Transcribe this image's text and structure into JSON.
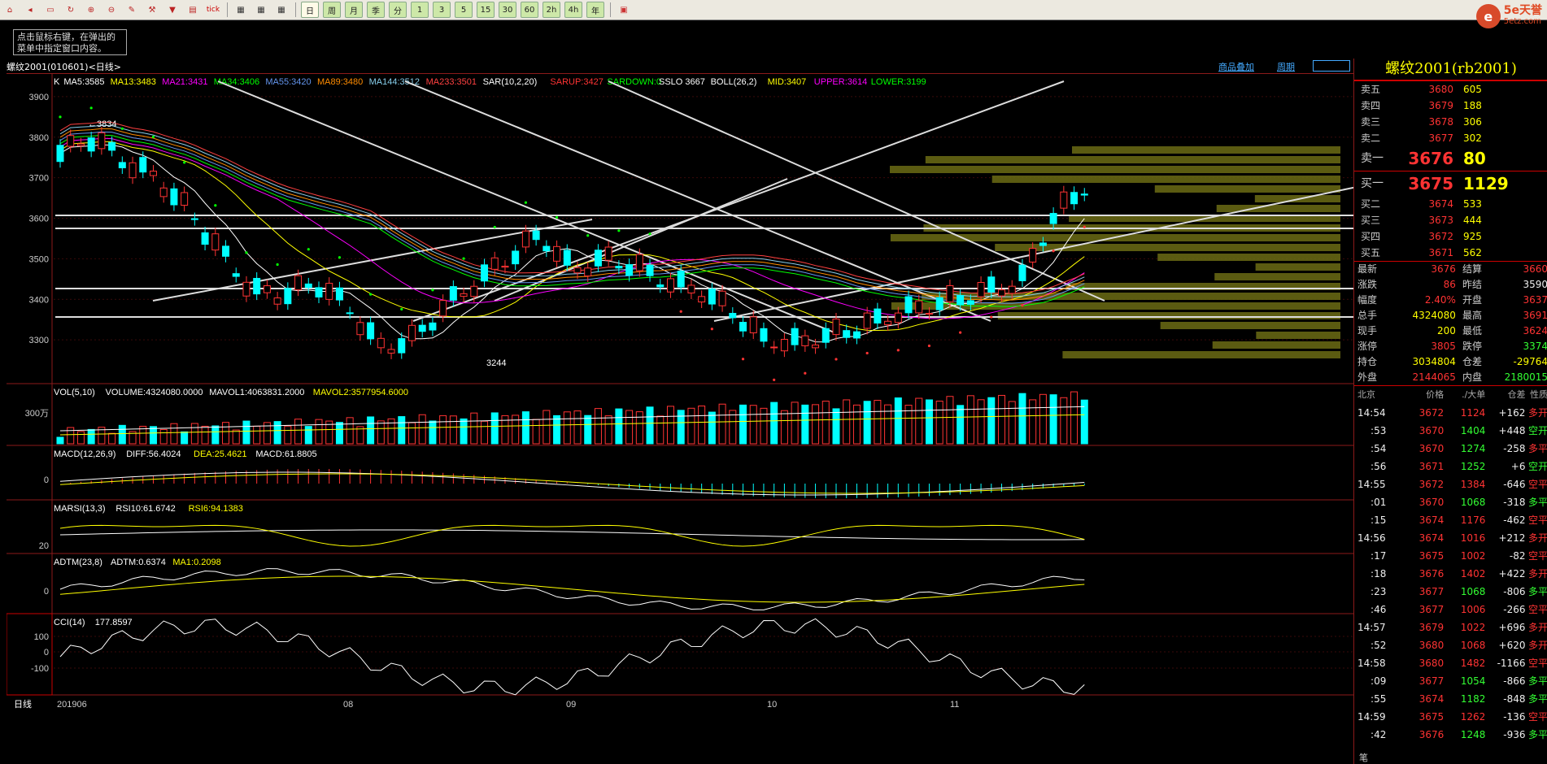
{
  "toolbar": {
    "icons": [
      "home-icon",
      "back-icon",
      "folder-icon",
      "refresh-icon",
      "zoom-in-icon",
      "zoom-out-icon",
      "pen-icon",
      "tool-icon",
      "filter-icon",
      "news-icon"
    ],
    "periods": [
      "日",
      "周",
      "月",
      "季",
      "分",
      "1",
      "3",
      "5",
      "15",
      "30",
      "60",
      "2h",
      "4h",
      "年"
    ],
    "tick_label": "tick",
    "active_period": "日"
  },
  "logo": {
    "brand": "5e天誉",
    "domain": "5etz.com"
  },
  "hint": {
    "text": "点击鼠标右键，在弹出的菜单中指定窗口内容。"
  },
  "header": {
    "symbol": "螺纹2001",
    "code": "(010601)",
    "period": "<日线>",
    "link_add": "商品叠加",
    "link_period": "周期"
  },
  "main_indicators": [
    {
      "text": "K",
      "color": "#ffffff"
    },
    {
      "text": "MA5:3585",
      "color": "#ffffff"
    },
    {
      "text": "MA13:3483",
      "color": "#ffff00"
    },
    {
      "text": "MA21:3431",
      "color": "#ff00ff"
    },
    {
      "text": "MA34:3406",
      "color": "#00ff00"
    },
    {
      "text": "MA55:3420",
      "color": "#6495ed"
    },
    {
      "text": "MA89:3480",
      "color": "#ff8c00"
    },
    {
      "text": "MA144:3512",
      "color": "#87ceeb"
    },
    {
      "text": "MA233:3501",
      "color": "#ff4040"
    },
    {
      "text": "SAR(10,2,20)",
      "color": "#ffffff"
    },
    {
      "text": "SARUP:3427",
      "color": "#ff3333"
    },
    {
      "text": "SARDOWN:0",
      "color": "#00ff00"
    },
    {
      "text": "SSLO 3667",
      "color": "#ffffff"
    },
    {
      "text": "BOLL(26,2)",
      "color": "#ffffff"
    },
    {
      "text": "MID:3407",
      "color": "#ffff00"
    },
    {
      "text": "UPPER:3614",
      "color": "#ff00ff"
    },
    {
      "text": "LOWER:3199",
      "color": "#00ff00"
    }
  ],
  "price_axis": [
    "3900",
    "3800",
    "3700",
    "3600",
    "3500",
    "3400",
    "3300"
  ],
  "price_high_label": "3834",
  "price_low_label": "3244",
  "vol_header": [
    {
      "text": "VOL(5,10)",
      "color": "#ffffff"
    },
    {
      "text": "VOLUME:4324080.0000",
      "color": "#ffffff"
    },
    {
      "text": "MAVOL1:4063831.2000",
      "color": "#ffffff"
    },
    {
      "text": "MAVOL2:3577954.6000",
      "color": "#ffff00"
    }
  ],
  "vol_axis": "300万",
  "macd_header": [
    {
      "text": "MACD(12,26,9)",
      "color": "#ffffff"
    },
    {
      "text": "DIFF:56.4024",
      "color": "#ffffff"
    },
    {
      "text": "DEA:25.4621",
      "color": "#ffff00"
    },
    {
      "text": "MACD:61.8805",
      "color": "#ffffff"
    }
  ],
  "macd_axis": "0",
  "marsi_header": [
    {
      "text": "MARSI(13,3)",
      "color": "#ffffff"
    },
    {
      "text": "RSI10:61.6742",
      "color": "#ffffff"
    },
    {
      "text": "RSI6:94.1383",
      "color": "#ffff00"
    }
  ],
  "marsi_axis": "20",
  "adtm_header": [
    {
      "text": "ADTM(23,8)",
      "color": "#ffffff"
    },
    {
      "text": "ADTM:0.6374",
      "color": "#ffffff"
    },
    {
      "text": "MA1:0.2098",
      "color": "#ffff00"
    }
  ],
  "adtm_axis": "0",
  "cci_header": [
    {
      "text": "CCI(14)",
      "color": "#ffffff"
    },
    {
      "text": "177.8597",
      "color": "#ffffff"
    }
  ],
  "cci_axis": [
    "100",
    "0",
    "-100"
  ],
  "date_axis": [
    "日线",
    "201906",
    "08",
    "09",
    "10",
    "11"
  ],
  "quote": {
    "title": "螺纹2001(rb2001)",
    "asks": [
      {
        "label": "卖五",
        "price": "3680",
        "vol": "605"
      },
      {
        "label": "卖四",
        "price": "3679",
        "vol": "188"
      },
      {
        "label": "卖三",
        "price": "3678",
        "vol": "306"
      },
      {
        "label": "卖二",
        "price": "3677",
        "vol": "302"
      },
      {
        "label": "卖一",
        "price": "3676",
        "vol": "80"
      }
    ],
    "bids": [
      {
        "label": "买一",
        "price": "3675",
        "vol": "1129"
      },
      {
        "label": "买二",
        "price": "3674",
        "vol": "533"
      },
      {
        "label": "买三",
        "price": "3673",
        "vol": "444"
      },
      {
        "label": "买四",
        "price": "3672",
        "vol": "925"
      },
      {
        "label": "买五",
        "price": "3671",
        "vol": "562"
      }
    ],
    "stats": [
      {
        "k1": "最新",
        "v1": "3676",
        "c1": "red",
        "k2": "结算",
        "v2": "3660",
        "c2": "red"
      },
      {
        "k1": "涨跌",
        "v1": "86",
        "c1": "red",
        "k2": "昨结",
        "v2": "3590",
        "c2": "white"
      },
      {
        "k1": "幅度",
        "v1": "2.40%",
        "c1": "red",
        "k2": "开盘",
        "v2": "3637",
        "c2": "red"
      },
      {
        "k1": "总手",
        "v1": "4324080",
        "c1": "yellow",
        "k2": "最高",
        "v2": "3691",
        "c2": "red"
      },
      {
        "k1": "现手",
        "v1": "200",
        "c1": "yellow",
        "k2": "最低",
        "v2": "3624",
        "c2": "red"
      },
      {
        "k1": "涨停",
        "v1": "3805",
        "c1": "red",
        "k2": "跌停",
        "v2": "3374",
        "c2": "green"
      },
      {
        "k1": "持仓",
        "v1": "3034804",
        "c1": "yellow",
        "k2": "仓差",
        "v2": "-29764",
        "c2": "yellow"
      },
      {
        "k1": "外盘",
        "v1": "2144065",
        "c1": "red",
        "k2": "内盘",
        "v2": "2180015",
        "c2": "green"
      }
    ],
    "ticks_header": [
      "北京",
      "价格",
      "./大单",
      "仓差",
      "性质"
    ],
    "ticks": [
      {
        "t": "14:54",
        "p": "3672",
        "v": "1124",
        "vc": "red",
        "d": "+162",
        "dc": "white",
        "n": "多开",
        "nc": "red"
      },
      {
        "t": ":53",
        "p": "3670",
        "v": "1404",
        "vc": "green",
        "d": "+448",
        "dc": "white",
        "n": "空开",
        "nc": "green"
      },
      {
        "t": ":54",
        "p": "3670",
        "v": "1274",
        "vc": "green",
        "d": "-258",
        "dc": "white",
        "n": "多平",
        "nc": "red"
      },
      {
        "t": ":56",
        "p": "3671",
        "v": "1252",
        "vc": "green",
        "d": "+6",
        "dc": "white",
        "n": "空开",
        "nc": "green"
      },
      {
        "t": "14:55",
        "p": "3672",
        "v": "1384",
        "vc": "red",
        "d": "-646",
        "dc": "white",
        "n": "空平",
        "nc": "red"
      },
      {
        "t": ":01",
        "p": "3670",
        "v": "1068",
        "vc": "green",
        "d": "-318",
        "dc": "white",
        "n": "多平",
        "nc": "green"
      },
      {
        "t": ":15",
        "p": "3674",
        "v": "1176",
        "vc": "red",
        "d": "-462",
        "dc": "white",
        "n": "空平",
        "nc": "red"
      },
      {
        "t": "14:56",
        "p": "3674",
        "v": "1016",
        "vc": "red",
        "d": "+212",
        "dc": "white",
        "n": "多开",
        "nc": "red"
      },
      {
        "t": ":17",
        "p": "3675",
        "v": "1002",
        "vc": "red",
        "d": "-82",
        "dc": "white",
        "n": "空平",
        "nc": "red"
      },
      {
        "t": ":18",
        "p": "3676",
        "v": "1402",
        "vc": "red",
        "d": "+422",
        "dc": "white",
        "n": "多开",
        "nc": "red"
      },
      {
        "t": ":23",
        "p": "3677",
        "v": "1068",
        "vc": "green",
        "d": "-806",
        "dc": "white",
        "n": "多平",
        "nc": "green"
      },
      {
        "t": ":46",
        "p": "3677",
        "v": "1006",
        "vc": "red",
        "d": "-266",
        "dc": "white",
        "n": "空平",
        "nc": "red"
      },
      {
        "t": "14:57",
        "p": "3679",
        "v": "1022",
        "vc": "red",
        "d": "+696",
        "dc": "white",
        "n": "多开",
        "nc": "red"
      },
      {
        "t": ":52",
        "p": "3680",
        "v": "1068",
        "vc": "red",
        "d": "+620",
        "dc": "white",
        "n": "多开",
        "nc": "red"
      },
      {
        "t": "14:58",
        "p": "3680",
        "v": "1482",
        "vc": "red",
        "d": "-1166",
        "dc": "white",
        "n": "空平",
        "nc": "red"
      },
      {
        "t": ":09",
        "p": "3677",
        "v": "1054",
        "vc": "green",
        "d": "-866",
        "dc": "white",
        "n": "多平",
        "nc": "green"
      },
      {
        "t": ":55",
        "p": "3674",
        "v": "1182",
        "vc": "green",
        "d": "-848",
        "dc": "white",
        "n": "多平",
        "nc": "green"
      },
      {
        "t": "14:59",
        "p": "3675",
        "v": "1262",
        "vc": "red",
        "d": "-136",
        "dc": "white",
        "n": "空平",
        "nc": "red"
      },
      {
        "t": ":42",
        "p": "3676",
        "v": "1248",
        "vc": "green",
        "d": "-936",
        "dc": "white",
        "n": "多平",
        "nc": "green"
      }
    ],
    "footer_label": "笔"
  }
}
